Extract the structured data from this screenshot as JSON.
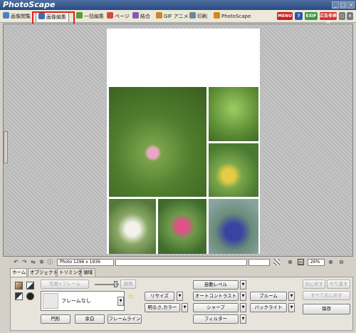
{
  "window": {
    "title": "PhotoScape"
  },
  "tabs": [
    {
      "label": "画像閲覧",
      "color": "#4a7fc1"
    },
    {
      "label": "画像編集",
      "color": "#3a6fb0"
    },
    {
      "label": "一括編集",
      "color": "#5a9a3a"
    },
    {
      "label": "ページ",
      "color": "#d24a3a"
    },
    {
      "label": "結合",
      "color": "#8a5ab0"
    },
    {
      "label": "GIF アニメ",
      "color": "#c78a2a"
    },
    {
      "label": "印刷",
      "color": "#6a8a9a"
    },
    {
      "label": "PhotoScape",
      "color": "#d08a1a"
    }
  ],
  "title_buttons": {
    "menu": "MENU",
    "help": "?",
    "exif": "EXIF",
    "hide": "広告非表示"
  },
  "status": {
    "photo_info": "Photo 1296 x 1936",
    "zoom": "26%"
  },
  "subtabs": [
    "ホーム",
    "オブジェクト",
    "トリミング",
    "領域"
  ],
  "panel": {
    "photo_frame": "写真+フレーム",
    "frame_select": "フレームなし",
    "apply": "適用",
    "rounded": "円形",
    "margin": "余白",
    "frame_line": "フレームライン",
    "resize": "リサイズ",
    "bright_color": "明るさ,カラー",
    "auto_level": "自動レベル",
    "auto_contrast": "オートコントラスト",
    "sharpen": "シャープ",
    "filter": "フィルター",
    "bloom": "ブルーム",
    "backlight": "バックライト",
    "restore": "元に戻す",
    "redo": "やり直す",
    "restore_all": "すべて元に戻す",
    "save": "保存"
  }
}
